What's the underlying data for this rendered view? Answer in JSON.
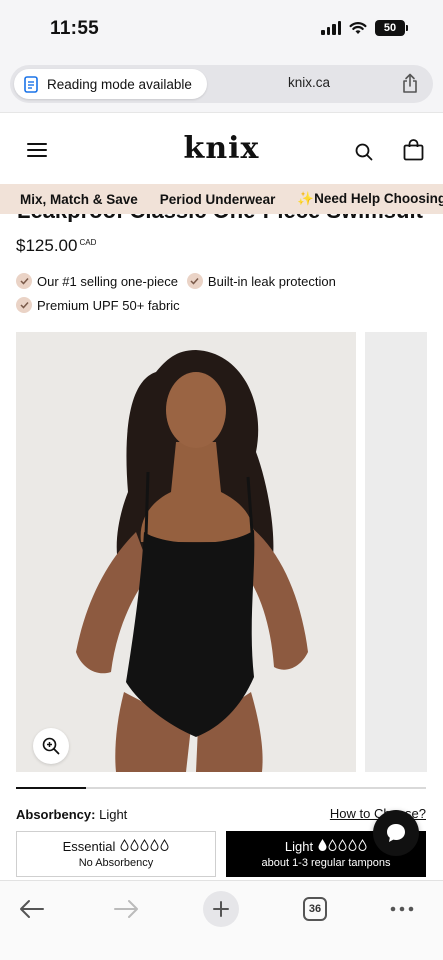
{
  "status_bar": {
    "time": "11:55",
    "battery": "50"
  },
  "browser": {
    "reading_mode": "Reading mode available",
    "url": "knix.ca"
  },
  "header": {
    "logo": "knix"
  },
  "promo": {
    "items": [
      "Mix, Match & Save",
      "Period Underwear",
      "Need Help Choosing?"
    ],
    "sparkle": "✨"
  },
  "product": {
    "title": "Leakproof Classic One-Piece Swimsuit",
    "price": "$125.00",
    "currency": "CAD",
    "features": [
      "Our #1 selling one-piece",
      "Built-in leak protection",
      "Premium UPF 50+ fabric"
    ],
    "gallery_progress": 0.17
  },
  "absorbency": {
    "label": "Absorbency:",
    "selected": "Light",
    "help_link": "How to Choose?",
    "options": [
      {
        "name": "Essential",
        "drops": 0,
        "description": "No Absorbency"
      },
      {
        "name": "Light",
        "drops": 1,
        "description": "about 1-3 regular tampons"
      }
    ]
  },
  "toolbar": {
    "tab_count": "36"
  },
  "colors": {
    "promo_bg": "#f1e2d8",
    "check_bg": "#ead3c6",
    "selected_option": "#000000"
  }
}
